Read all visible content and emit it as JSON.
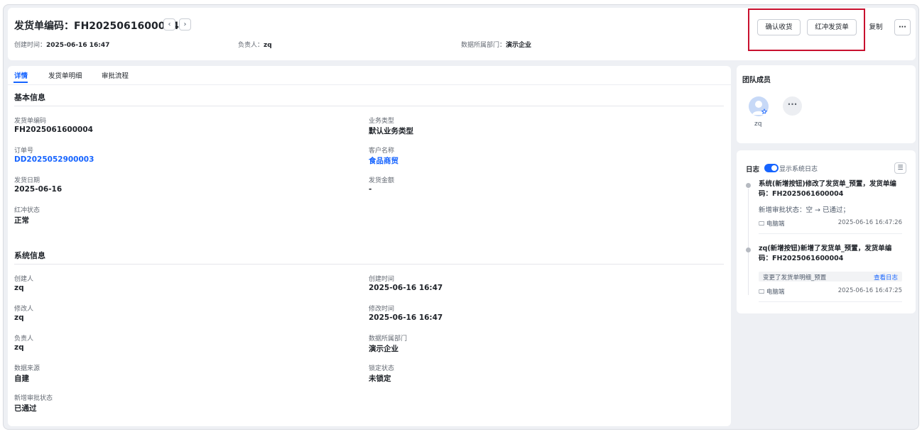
{
  "header": {
    "title": "发货单编码：FH2025061600004",
    "prev_icon": "chevron-left-icon",
    "next_icon": "chevron-right-icon",
    "meta": {
      "created_label": "创建时间：",
      "created_value": "2025-06-16 16:47",
      "owner_label": "负责人：",
      "owner_value": "zq",
      "dept_label": "数据所属部门：",
      "dept_value": "演示企业"
    },
    "actions": {
      "confirm_receipt": "确认收货",
      "red_reversal": "红冲发货单",
      "copy": "复制",
      "more": "···"
    }
  },
  "tabs": [
    "详情",
    "发货单明细",
    "审批流程"
  ],
  "basic_info": {
    "title": "基本信息",
    "fields": [
      {
        "label": "发货单编码",
        "value": "FH2025061600004"
      },
      {
        "label": "业务类型",
        "value": "默认业务类型"
      },
      {
        "label": "订单号",
        "value": "DD2025052900003"
      },
      {
        "label": "客户名称",
        "value": "食品商贸"
      },
      {
        "label": "发货日期",
        "value": "2025-06-16"
      },
      {
        "label": "发货金额",
        "value": "-"
      },
      {
        "label": "红冲状态",
        "value": "正常"
      }
    ]
  },
  "system_info": {
    "title": "系统信息",
    "fields": [
      {
        "label": "创建人",
        "value": "zq"
      },
      {
        "label": "创建时间",
        "value": "2025-06-16 16:47"
      },
      {
        "label": "修改人",
        "value": "zq"
      },
      {
        "label": "修改时间",
        "value": "2025-06-16 16:47"
      },
      {
        "label": "负责人",
        "value": "zq"
      },
      {
        "label": "数据所属部门",
        "value": "演示企业"
      },
      {
        "label": "数据来源",
        "value": "自建"
      },
      {
        "label": "锁定状态",
        "value": "未锁定"
      },
      {
        "label": "新增审批状态",
        "value": "已通过"
      }
    ]
  },
  "team": {
    "title": "团队成员",
    "members": [
      {
        "name": "zq"
      }
    ],
    "more": "···"
  },
  "log": {
    "title": "日志",
    "toggle_label": "显示系统日志",
    "toggle_on": true,
    "entries": [
      {
        "headline": "系统(新增按钮)修改了发货单_预置，发货单编码：FH2025061600004",
        "detail": "新增审批状态：空 → 已通过；",
        "source": "电脑端",
        "time": "2025-06-16 16:47:26"
      },
      {
        "headline": "zq(新增按钮)新增了发货单_预置，发货单编码：FH2025061600004",
        "change": "变更了发货单明细_预置",
        "change_link": "查看日志",
        "source": "电脑端",
        "time": "2025-06-16 16:47:25"
      }
    ]
  },
  "colors": {
    "accent": "#1664ff",
    "highlight_box": "#c8102e",
    "panel_bg": "#eef0f4"
  }
}
